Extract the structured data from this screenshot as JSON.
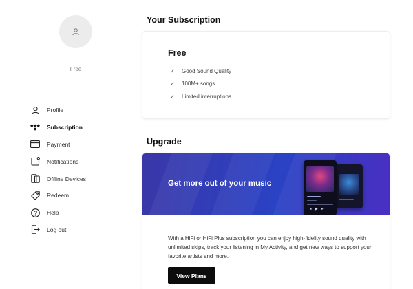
{
  "profile": {
    "plan_label": "Free",
    "avatar_icon": "user-icon"
  },
  "sidebar": {
    "items": [
      {
        "label": "Profile",
        "icon": "user-icon",
        "active": false
      },
      {
        "label": "Subscription",
        "icon": "tidal-logo-icon",
        "active": true
      },
      {
        "label": "Payment",
        "icon": "credit-card-icon",
        "active": false
      },
      {
        "label": "Notifications",
        "icon": "bell-icon",
        "active": false
      },
      {
        "label": "Offline Devices",
        "icon": "devices-icon",
        "active": false
      },
      {
        "label": "Redeem",
        "icon": "tag-icon",
        "active": false
      },
      {
        "label": "Help",
        "icon": "help-icon",
        "active": false
      },
      {
        "label": "Log out",
        "icon": "logout-icon",
        "active": false
      }
    ]
  },
  "subscription": {
    "heading": "Your Subscription",
    "plan_name": "Free",
    "features": [
      "Good Sound Quality",
      "100M+ songs",
      "Limited interruptions"
    ]
  },
  "upgrade": {
    "heading": "Upgrade",
    "banner_title": "Get more out of your music",
    "description": "With a HiFi or HiFi Plus subscription you can enjoy high-fidelity sound quality with unlimited skips, track your listening in My Activity, and get new ways to support your favorite artists and more.",
    "button_label": "View Plans"
  },
  "colors": {
    "banner_start": "#3a37a8",
    "banner_end": "#4a2fc2",
    "button_bg": "#0c0c0c",
    "accent_text": "#111111"
  }
}
